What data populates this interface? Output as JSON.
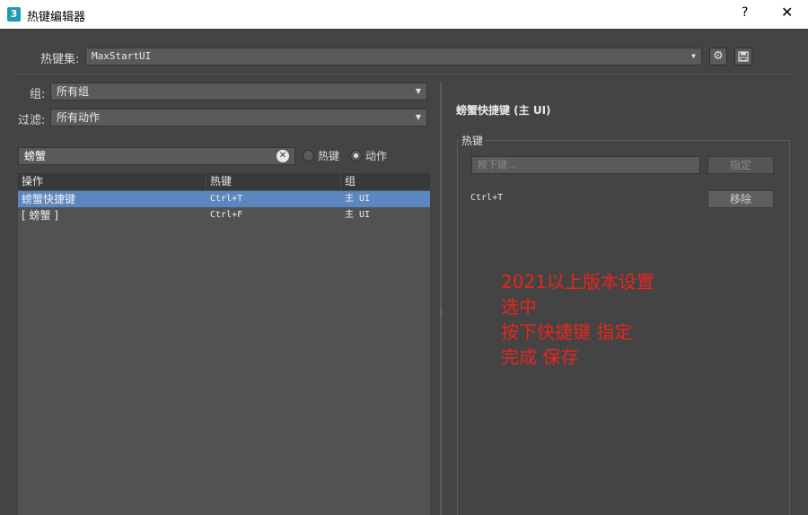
{
  "window": {
    "title": "热键编辑器",
    "app_icon_text": "3",
    "help": "?",
    "close": "✕"
  },
  "hotkey_set": {
    "label": "热键集:",
    "value": "MaxStartUI"
  },
  "filters": {
    "group_label": "组:",
    "group_value": "所有组",
    "filter_label": "过滤:",
    "filter_value": "所有动作"
  },
  "search": {
    "value": "螃蟹",
    "clear": "✕"
  },
  "search_mode": {
    "options": [
      "热键",
      "动作"
    ],
    "selected": "动作"
  },
  "table": {
    "headers": [
      "操作",
      "热键",
      "组"
    ],
    "rows": [
      {
        "action": "螃蟹快捷键",
        "hotkey": "Ctrl+T",
        "group": "主 UI",
        "selected": true
      },
      {
        "action": "[ 螃蟹 ]",
        "hotkey": "Ctrl+F",
        "group": "主 UI",
        "selected": false
      }
    ]
  },
  "detail": {
    "title": "螃蟹快捷键 (主 UI)",
    "hotkey_group_label": "热键",
    "input_placeholder": "按下键...",
    "assign_label": "指定",
    "assigned_hotkey": "Ctrl+T",
    "remove_label": "移除"
  },
  "annotation": {
    "lines": [
      "2021以上版本设置",
      "选中",
      "按下快捷键 指定",
      "完成 保存"
    ],
    "color": "#e8251e"
  },
  "colors": {
    "selection": "#5c86c0",
    "background": "#444444"
  }
}
